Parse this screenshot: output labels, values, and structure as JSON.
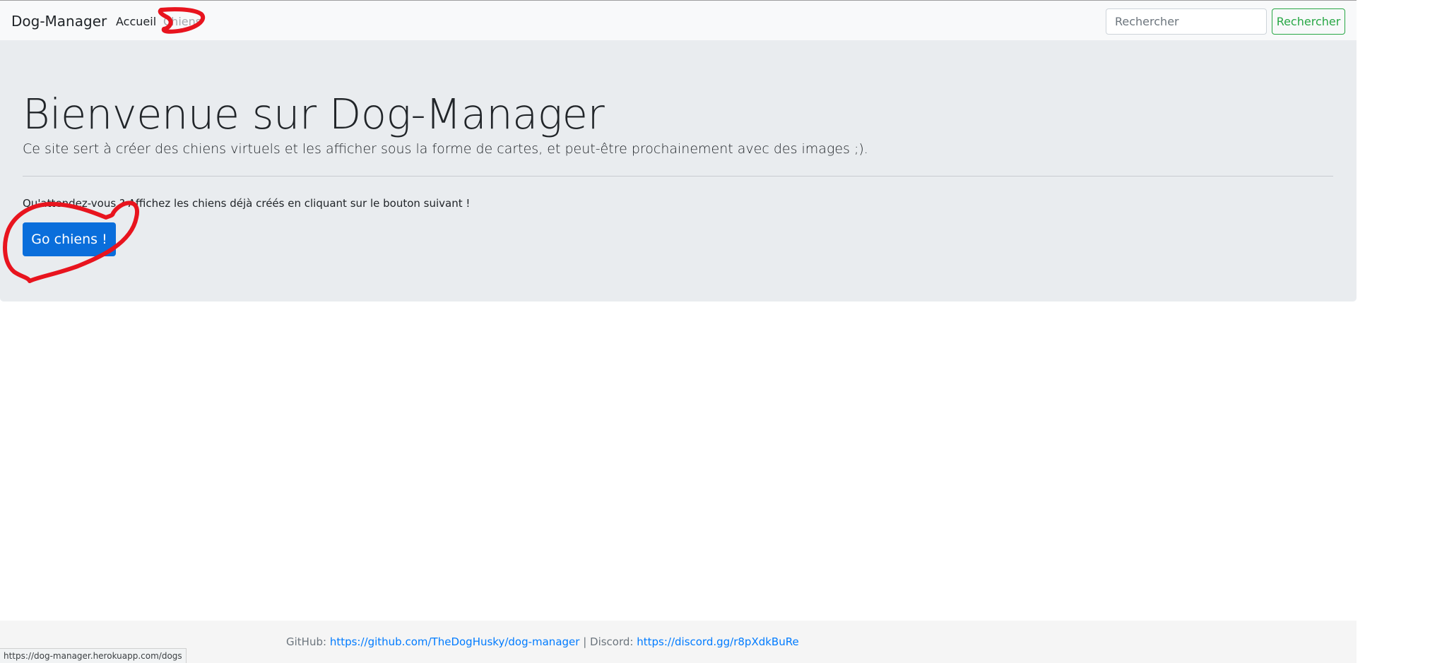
{
  "navbar": {
    "brand": "Dog-Manager",
    "links": [
      {
        "label": "Accueil"
      },
      {
        "label": "Chiens"
      }
    ],
    "search": {
      "placeholder": "Rechercher",
      "value": "",
      "button_label": "Rechercher"
    },
    "colors": {
      "background": "#f8f9fa",
      "search_button": "#28a745"
    }
  },
  "jumbotron": {
    "title": "Bienvenue sur Dog-Manager",
    "lead": "Ce site sert à créer des chiens virtuels et les afficher sous la forme de cartes, et peut-être prochainement avec des images ;).",
    "body": "Qu'attendez-vous ? Affichez les chiens déjà créés en cliquant sur le bouton suivant !",
    "button_label": "Go chiens !",
    "colors": {
      "background": "#e9ecef",
      "button": "#0a6edb"
    }
  },
  "footer": {
    "github_label": "GitHub: ",
    "github_url": "https://github.com/TheDogHusky/dog-manager",
    "separator": " | Discord: ",
    "discord_url": "https://discord.gg/r8pXdkBuRe"
  },
  "status_bar": {
    "url": "https://dog-manager.herokuapp.com/dogs"
  },
  "annotations": {
    "color": "#e8141e"
  }
}
